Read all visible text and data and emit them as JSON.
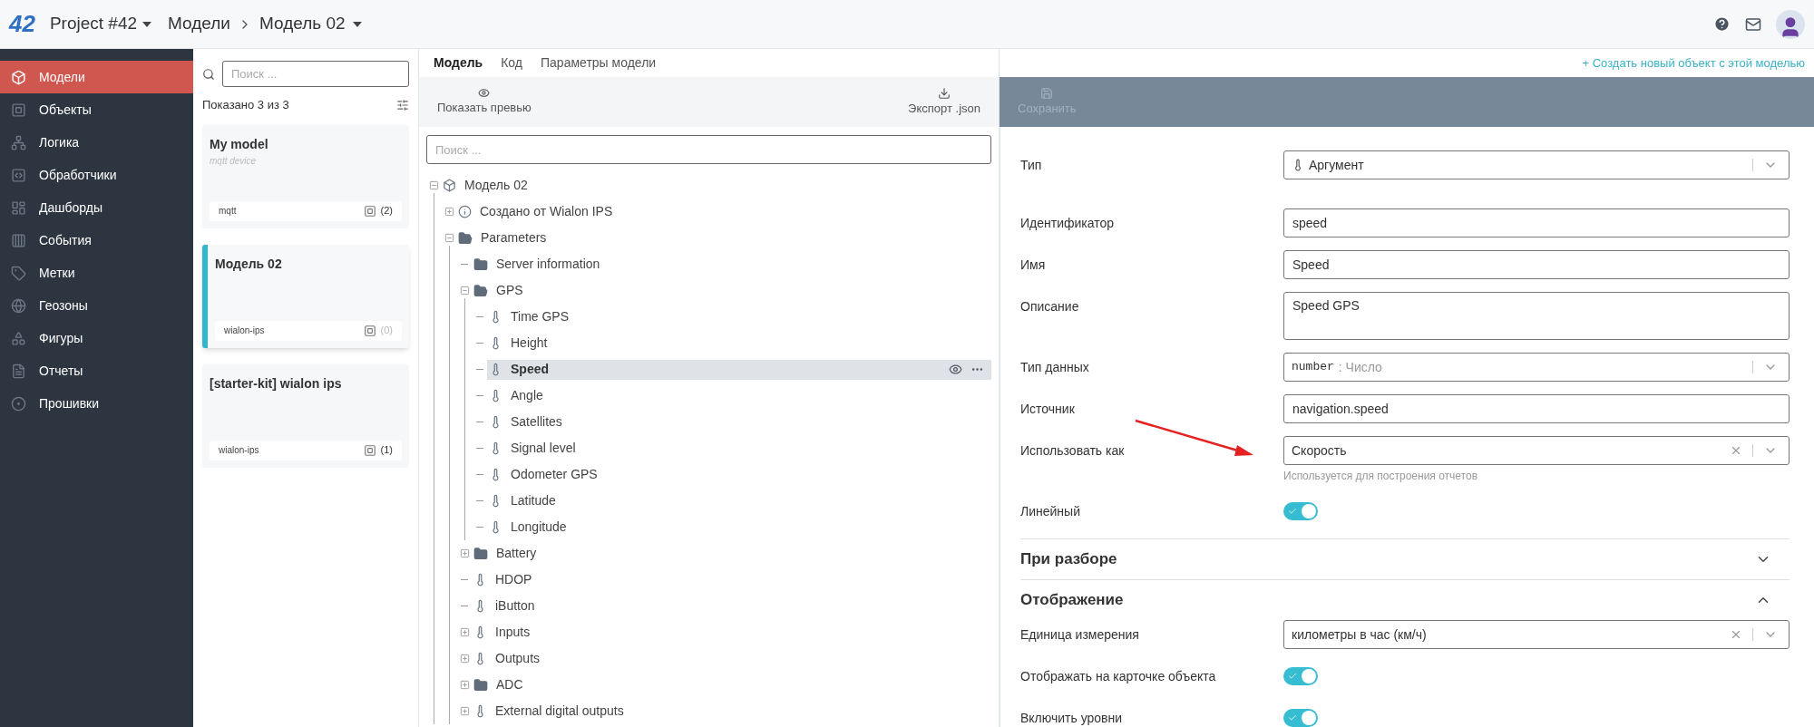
{
  "topbar": {
    "logo": "42",
    "project": "Project #42",
    "breadcrumb": [
      "Модели",
      "Модель 02"
    ]
  },
  "sidebar": {
    "items": [
      {
        "label": "Модели",
        "selected": true
      },
      {
        "label": "Объекты",
        "selected": false
      },
      {
        "label": "Логика",
        "selected": false
      },
      {
        "label": "Обработчики",
        "selected": false
      },
      {
        "label": "Дашборды",
        "selected": false
      },
      {
        "label": "События",
        "selected": false
      },
      {
        "label": "Метки",
        "selected": false
      },
      {
        "label": "Геозоны",
        "selected": false
      },
      {
        "label": "Фигуры",
        "selected": false
      },
      {
        "label": "Отчеты",
        "selected": false
      },
      {
        "label": "Прошивки",
        "selected": false
      }
    ]
  },
  "model_list": {
    "search": {
      "placeholder": "Поиск ..."
    },
    "count": "Показано 3 из 3",
    "cards": [
      {
        "title": "My model",
        "subtitle": "mqtt device",
        "tag": "mqtt",
        "objects": "(2)",
        "objects_dimmed": false,
        "selected": false
      },
      {
        "title": "Модель 02",
        "tag": "wialon-ips",
        "objects": "(0)",
        "objects_dimmed": true,
        "selected": true
      },
      {
        "title": "[starter-kit] wialon ips",
        "tag": "wialon-ips",
        "objects": "(1)",
        "objects_dimmed": false,
        "selected": false
      }
    ]
  },
  "center": {
    "tabs": [
      {
        "label": "Модель",
        "selected": true
      },
      {
        "label": "Код",
        "selected": false
      },
      {
        "label": "Параметры модели",
        "selected": false
      }
    ],
    "toolbar": {
      "preview": "Показать превью",
      "export": "Экспорт .json"
    },
    "search": {
      "placeholder": "Поиск ..."
    },
    "tree": [
      {
        "label": "Модель 02",
        "kind": "model",
        "expanded": true,
        "selected": false,
        "children": [
          {
            "label": "Создано от Wialon IPS",
            "kind": "info",
            "expanded": false,
            "selected": false
          },
          {
            "label": "Parameters",
            "kind": "folder",
            "expanded": true,
            "selected": false,
            "children": [
              {
                "label": "Server information",
                "kind": "folder",
                "selected": false
              },
              {
                "label": "GPS",
                "kind": "folder",
                "expanded": true,
                "selected": false,
                "children": [
                  {
                    "label": "Time GPS",
                    "kind": "param",
                    "selected": false
                  },
                  {
                    "label": "Height",
                    "kind": "param",
                    "selected": false
                  },
                  {
                    "label": "Speed",
                    "kind": "param",
                    "selected": true
                  },
                  {
                    "label": "Angle",
                    "kind": "param",
                    "selected": false
                  },
                  {
                    "label": "Satellites",
                    "kind": "param",
                    "selected": false
                  },
                  {
                    "label": "Signal level",
                    "kind": "param",
                    "selected": false
                  },
                  {
                    "label": "Odometer GPS",
                    "kind": "param",
                    "selected": false
                  },
                  {
                    "label": "Latitude",
                    "kind": "param",
                    "selected": false
                  },
                  {
                    "label": "Longitude",
                    "kind": "param",
                    "selected": false
                  }
                ]
              },
              {
                "label": "Battery",
                "kind": "folder",
                "expanded": false,
                "selected": false
              },
              {
                "label": "HDOP",
                "kind": "param",
                "selected": false
              },
              {
                "label": "iButton",
                "kind": "param",
                "selected": false
              },
              {
                "label": "Inputs",
                "kind": "param",
                "expanded": false,
                "selected": false
              },
              {
                "label": "Outputs",
                "kind": "param",
                "expanded": false,
                "selected": false
              },
              {
                "label": "ADC",
                "kind": "folder",
                "expanded": false,
                "selected": false
              },
              {
                "label": "External digital outputs",
                "kind": "param",
                "expanded": false,
                "selected": false
              }
            ]
          }
        ]
      }
    ]
  },
  "editor": {
    "create_link": "+ Создать новый объект с этой моделью",
    "save": {
      "label": "Сохранить",
      "disabled": true
    },
    "fields": [
      {
        "kind": "select",
        "label": "Тип",
        "value": "Аргумент",
        "with_icon": true
      },
      {
        "kind": "input",
        "label": "Идентификатор",
        "value": "speed"
      },
      {
        "kind": "input",
        "label": "Имя",
        "value": "Speed"
      },
      {
        "kind": "textarea",
        "label": "Описание",
        "value": "Speed GPS"
      },
      {
        "kind": "select",
        "label": "Тип данных",
        "code": "number",
        "value": ": Число",
        "disabled": true
      },
      {
        "kind": "input",
        "label": "Источник",
        "value": "navigation.speed"
      },
      {
        "kind": "select",
        "label": "Использовать как",
        "value": "Скорость",
        "clearable": true,
        "hint": "Используется для построения отчетов"
      },
      {
        "kind": "toggle",
        "label": "Линейный",
        "on": true
      }
    ],
    "sections": [
      {
        "title": "При разборе",
        "expanded": false
      },
      {
        "title": "Отображение",
        "expanded": true,
        "fields": [
          {
            "kind": "select",
            "label": "Единица измерения",
            "value": "километры в час (км/ч)",
            "clearable": true
          },
          {
            "kind": "toggle",
            "label": "Отображать на карточке объекта",
            "on": true
          },
          {
            "kind": "toggle",
            "label": "Включить уровни",
            "on": true
          }
        ]
      }
    ]
  }
}
